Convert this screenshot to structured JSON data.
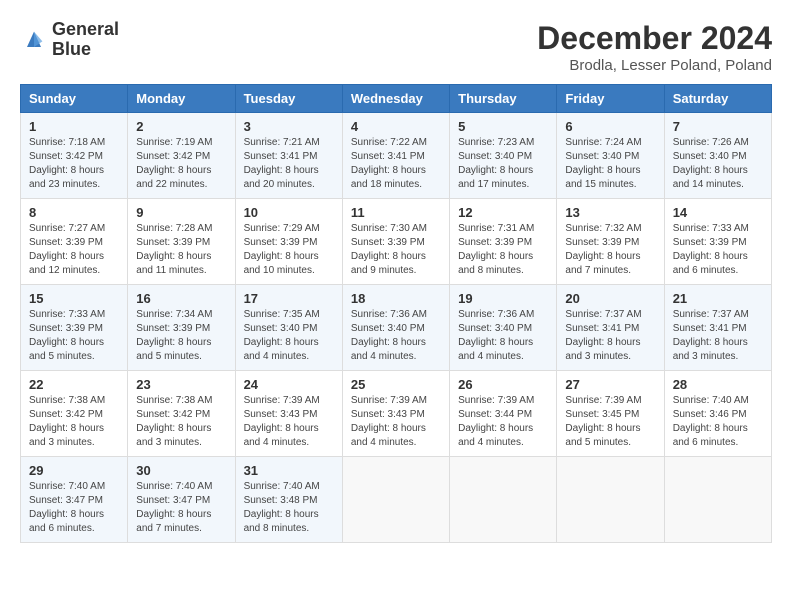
{
  "header": {
    "logo_line1": "General",
    "logo_line2": "Blue",
    "month_title": "December 2024",
    "location": "Brodla, Lesser Poland, Poland"
  },
  "days_of_week": [
    "Sunday",
    "Monday",
    "Tuesday",
    "Wednesday",
    "Thursday",
    "Friday",
    "Saturday"
  ],
  "weeks": [
    [
      {
        "num": "1",
        "sunrise": "7:18 AM",
        "sunset": "3:42 PM",
        "daylight": "8 hours and 23 minutes."
      },
      {
        "num": "2",
        "sunrise": "7:19 AM",
        "sunset": "3:42 PM",
        "daylight": "8 hours and 22 minutes."
      },
      {
        "num": "3",
        "sunrise": "7:21 AM",
        "sunset": "3:41 PM",
        "daylight": "8 hours and 20 minutes."
      },
      {
        "num": "4",
        "sunrise": "7:22 AM",
        "sunset": "3:41 PM",
        "daylight": "8 hours and 18 minutes."
      },
      {
        "num": "5",
        "sunrise": "7:23 AM",
        "sunset": "3:40 PM",
        "daylight": "8 hours and 17 minutes."
      },
      {
        "num": "6",
        "sunrise": "7:24 AM",
        "sunset": "3:40 PM",
        "daylight": "8 hours and 15 minutes."
      },
      {
        "num": "7",
        "sunrise": "7:26 AM",
        "sunset": "3:40 PM",
        "daylight": "8 hours and 14 minutes."
      }
    ],
    [
      {
        "num": "8",
        "sunrise": "7:27 AM",
        "sunset": "3:39 PM",
        "daylight": "8 hours and 12 minutes."
      },
      {
        "num": "9",
        "sunrise": "7:28 AM",
        "sunset": "3:39 PM",
        "daylight": "8 hours and 11 minutes."
      },
      {
        "num": "10",
        "sunrise": "7:29 AM",
        "sunset": "3:39 PM",
        "daylight": "8 hours and 10 minutes."
      },
      {
        "num": "11",
        "sunrise": "7:30 AM",
        "sunset": "3:39 PM",
        "daylight": "8 hours and 9 minutes."
      },
      {
        "num": "12",
        "sunrise": "7:31 AM",
        "sunset": "3:39 PM",
        "daylight": "8 hours and 8 minutes."
      },
      {
        "num": "13",
        "sunrise": "7:32 AM",
        "sunset": "3:39 PM",
        "daylight": "8 hours and 7 minutes."
      },
      {
        "num": "14",
        "sunrise": "7:33 AM",
        "sunset": "3:39 PM",
        "daylight": "8 hours and 6 minutes."
      }
    ],
    [
      {
        "num": "15",
        "sunrise": "7:33 AM",
        "sunset": "3:39 PM",
        "daylight": "8 hours and 5 minutes."
      },
      {
        "num": "16",
        "sunrise": "7:34 AM",
        "sunset": "3:39 PM",
        "daylight": "8 hours and 5 minutes."
      },
      {
        "num": "17",
        "sunrise": "7:35 AM",
        "sunset": "3:40 PM",
        "daylight": "8 hours and 4 minutes."
      },
      {
        "num": "18",
        "sunrise": "7:36 AM",
        "sunset": "3:40 PM",
        "daylight": "8 hours and 4 minutes."
      },
      {
        "num": "19",
        "sunrise": "7:36 AM",
        "sunset": "3:40 PM",
        "daylight": "8 hours and 4 minutes."
      },
      {
        "num": "20",
        "sunrise": "7:37 AM",
        "sunset": "3:41 PM",
        "daylight": "8 hours and 3 minutes."
      },
      {
        "num": "21",
        "sunrise": "7:37 AM",
        "sunset": "3:41 PM",
        "daylight": "8 hours and 3 minutes."
      }
    ],
    [
      {
        "num": "22",
        "sunrise": "7:38 AM",
        "sunset": "3:42 PM",
        "daylight": "8 hours and 3 minutes."
      },
      {
        "num": "23",
        "sunrise": "7:38 AM",
        "sunset": "3:42 PM",
        "daylight": "8 hours and 3 minutes."
      },
      {
        "num": "24",
        "sunrise": "7:39 AM",
        "sunset": "3:43 PM",
        "daylight": "8 hours and 4 minutes."
      },
      {
        "num": "25",
        "sunrise": "7:39 AM",
        "sunset": "3:43 PM",
        "daylight": "8 hours and 4 minutes."
      },
      {
        "num": "26",
        "sunrise": "7:39 AM",
        "sunset": "3:44 PM",
        "daylight": "8 hours and 4 minutes."
      },
      {
        "num": "27",
        "sunrise": "7:39 AM",
        "sunset": "3:45 PM",
        "daylight": "8 hours and 5 minutes."
      },
      {
        "num": "28",
        "sunrise": "7:40 AM",
        "sunset": "3:46 PM",
        "daylight": "8 hours and 6 minutes."
      }
    ],
    [
      {
        "num": "29",
        "sunrise": "7:40 AM",
        "sunset": "3:47 PM",
        "daylight": "8 hours and 6 minutes."
      },
      {
        "num": "30",
        "sunrise": "7:40 AM",
        "sunset": "3:47 PM",
        "daylight": "8 hours and 7 minutes."
      },
      {
        "num": "31",
        "sunrise": "7:40 AM",
        "sunset": "3:48 PM",
        "daylight": "8 hours and 8 minutes."
      },
      null,
      null,
      null,
      null
    ]
  ],
  "labels": {
    "sunrise": "Sunrise:",
    "sunset": "Sunset:",
    "daylight": "Daylight:"
  }
}
